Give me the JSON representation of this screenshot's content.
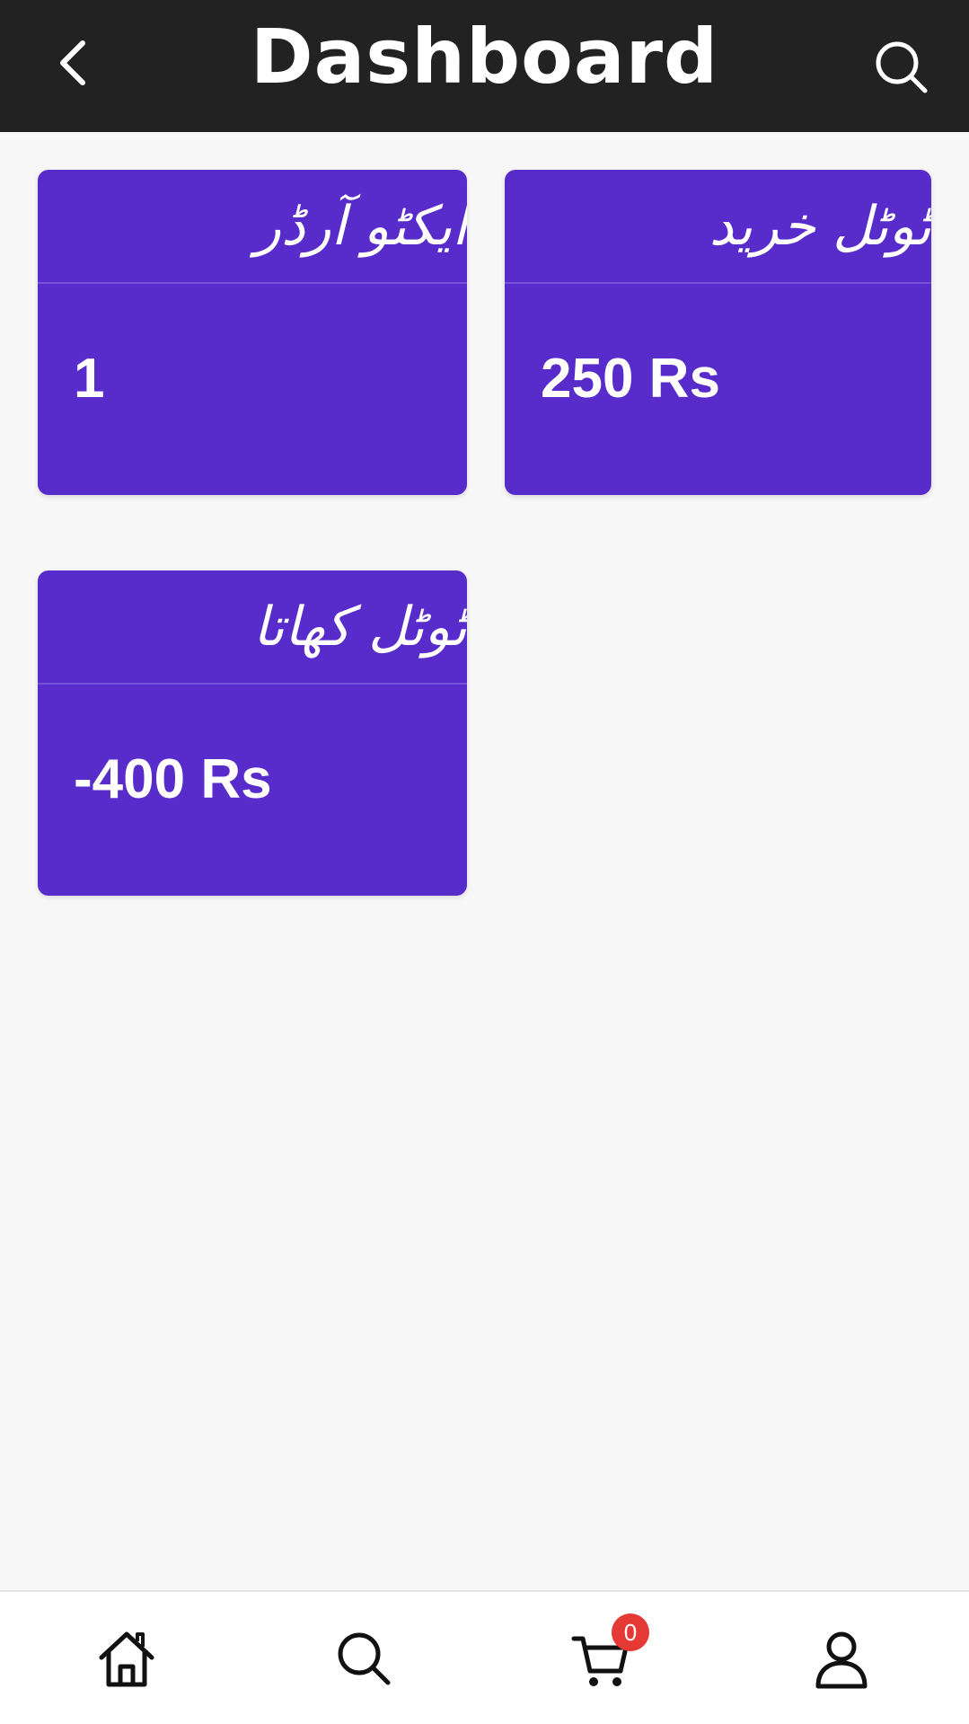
{
  "header": {
    "title": "Dashboard",
    "back_icon": "chevron-left-icon",
    "search_icon": "search-icon",
    "background": "#222222"
  },
  "cards": [
    {
      "title": "ایکٹو آرڈر",
      "value": "1"
    },
    {
      "title": "ٹوٹل خرید",
      "value": "250 Rs"
    },
    {
      "title": "ٹوٹل کھاتا",
      "value": "-400 Rs"
    }
  ],
  "card_color": "#582ccb",
  "bottom_nav": {
    "items": [
      {
        "icon": "home-icon"
      },
      {
        "icon": "search-icon"
      },
      {
        "icon": "cart-icon",
        "badge": "0"
      },
      {
        "icon": "profile-icon"
      }
    ],
    "badge_color": "#e53935"
  }
}
